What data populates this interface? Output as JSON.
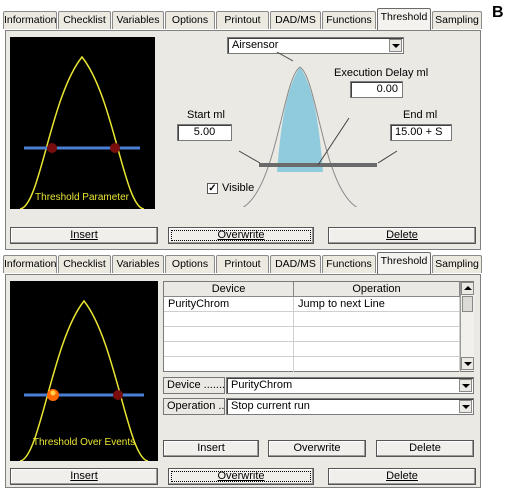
{
  "corner_label": "B",
  "tabs": [
    {
      "label": "Information"
    },
    {
      "label": "Checklist"
    },
    {
      "label": "Variables"
    },
    {
      "label": "Options"
    },
    {
      "label": "Printout"
    },
    {
      "label": "DAD/MS"
    },
    {
      "label": "Functions"
    },
    {
      "label": "Threshold",
      "active": true
    },
    {
      "label": "Sampling"
    }
  ],
  "panel_top": {
    "preview_caption": "Threshold Parameter",
    "sensor_select": "Airsensor",
    "execution_delay_label": "Execution Delay ml",
    "execution_delay_value": "0.00",
    "start_label": "Start ml",
    "start_value": "5.00",
    "end_label": "End ml",
    "end_value": "15.00 + S",
    "visible_label": "Visible",
    "visible_checked": "✓",
    "buttons": {
      "insert": "Insert",
      "overwrite": "Overwrite",
      "delete": "Delete"
    }
  },
  "panel_bottom": {
    "preview_caption": "Threshold Over Events",
    "table": {
      "columns": [
        "Device",
        "Operation"
      ],
      "rows": [
        [
          "PurityChrom",
          "Jump to next Line"
        ],
        [
          "",
          ""
        ],
        [
          "",
          ""
        ],
        [
          "",
          ""
        ],
        [
          "",
          ""
        ]
      ]
    },
    "device_label": "Device .......",
    "device_value": "PurityChrom",
    "operation_label": "Operation ...",
    "operation_value": "Stop current run",
    "inner_buttons": {
      "insert": "Insert",
      "overwrite": "Overwrite",
      "delete": "Delete"
    },
    "buttons": {
      "insert": "Insert",
      "overwrite": "Overwrite",
      "delete": "Delete"
    }
  },
  "colors": {
    "curve": "#e9e533",
    "threshold_line": "#4a7fd4",
    "marker": "#7a0d0d",
    "marker_active": "#ff6a00",
    "peak_fill": "#8fcbdc"
  }
}
